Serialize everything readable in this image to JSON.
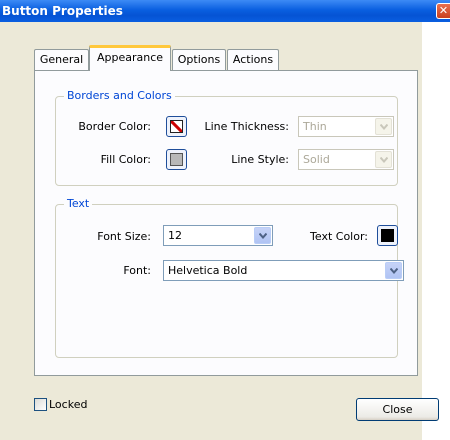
{
  "window": {
    "title": "Button Properties",
    "close_glyph": "✕"
  },
  "tabs": [
    {
      "label": "General"
    },
    {
      "label": "Appearance",
      "active": true
    },
    {
      "label": "Options"
    },
    {
      "label": "Actions"
    }
  ],
  "borders_group": {
    "legend": "Borders and Colors",
    "border_color_label": "Border Color:",
    "line_thickness_label": "Line Thickness:",
    "line_thickness_value": "Thin",
    "fill_color_label": "Fill Color:",
    "line_style_label": "Line Style:",
    "line_style_value": "Solid"
  },
  "text_group": {
    "legend": "Text",
    "font_size_label": "Font Size:",
    "font_size_value": "12",
    "text_color_label": "Text Color:",
    "font_label": "Font:",
    "font_value": "Helvetica Bold"
  },
  "footer": {
    "locked_label": "Locked",
    "close_label": "Close"
  },
  "colors": {
    "accent": "#0a5fe0",
    "group_legend": "#0046d5",
    "tab_highlight": "#ffc83c",
    "fill_swatch": "#b8b8b8",
    "text_swatch": "#000000",
    "border_swatch_stroke": "#cc0000"
  }
}
